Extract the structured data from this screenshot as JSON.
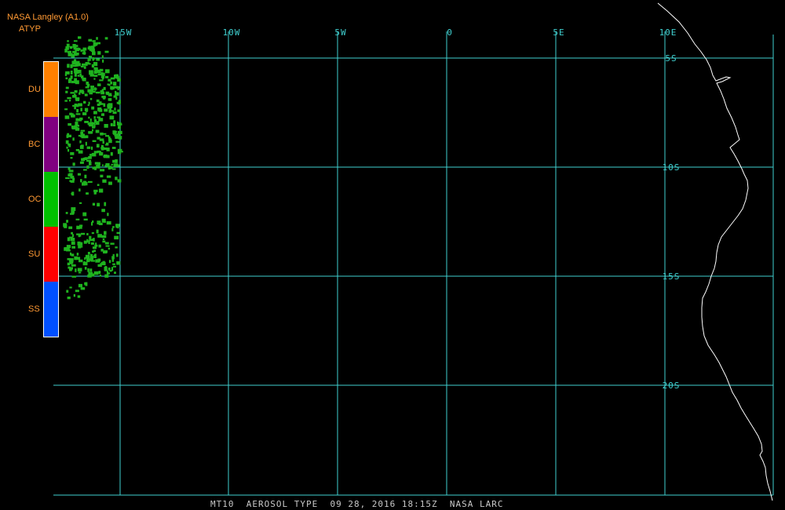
{
  "header": {
    "source": "NASA Langley (A1.0)",
    "product": "ATYP"
  },
  "legend": [
    {
      "label": "DU",
      "color": "#ff8000"
    },
    {
      "label": "BC",
      "color": "#800080"
    },
    {
      "label": "OC",
      "color": "#00c000"
    },
    {
      "label": "SU",
      "color": "#ff0000"
    },
    {
      "label": "SS",
      "color": "#0050ff"
    }
  ],
  "map": {
    "lon_labels": [
      "15W",
      "10W",
      "5W",
      "0",
      "5E",
      "10E"
    ],
    "lat_labels": [
      "5S",
      "10S",
      "15S",
      "20S"
    ],
    "grid_color": "#40d0d0",
    "coast_color": "#ffffff"
  },
  "footer": "MT10  AEROSOL TYPE  09 28, 2016 18:15Z  NASA LARC"
}
